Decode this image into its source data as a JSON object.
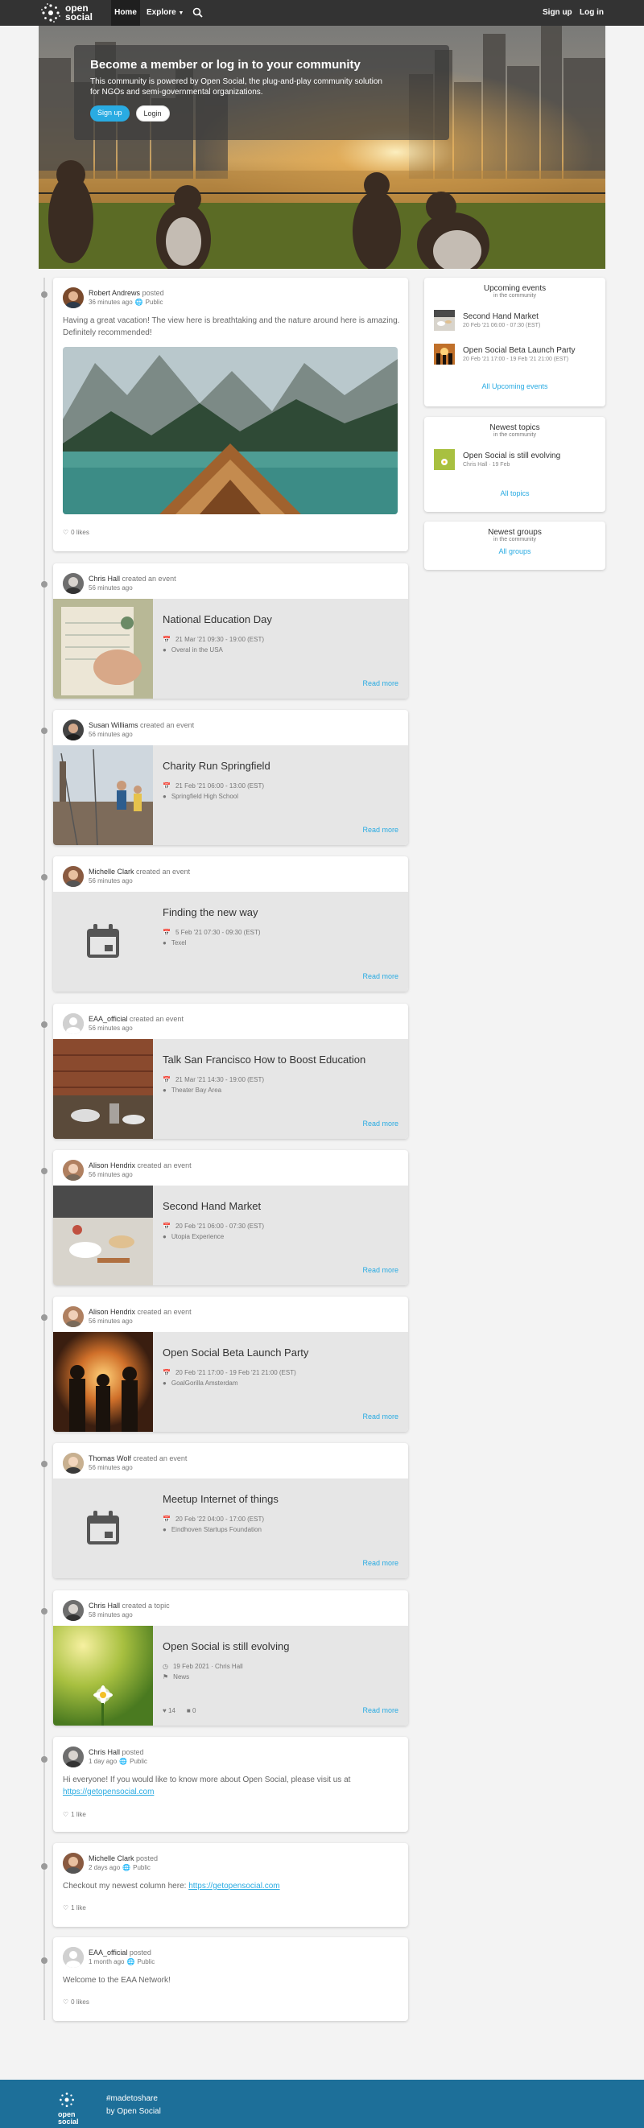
{
  "nav": {
    "logo_top": "open",
    "logo_bottom": "social",
    "home": "Home",
    "explore": "Explore",
    "sign_up": "Sign up",
    "login": "Log in"
  },
  "hero": {
    "title": "Become a member or log in to your community",
    "text": "This community is powered by Open Social, the plug-and-play community solution for NGOs and semi-governmental organizations.",
    "signup_btn": "Sign up",
    "login_btn": "Login"
  },
  "stream": [
    {
      "author": "Robert Andrews",
      "action": "posted",
      "time": "36 minutes ago",
      "visibility": "Public",
      "text": "Having a great vacation! The view here is breathtaking and the nature around here is amazing. Definitely recommended!",
      "likes": "0 likes"
    },
    {
      "author": "Chris Hall",
      "action": "created an event",
      "time": "56 minutes ago",
      "title": "National Education Day",
      "date": "21 Mar '21 09:30 - 19:00 (EST)",
      "location": "Overal in the USA",
      "read_more": "Read more"
    },
    {
      "author": "Susan Williams",
      "action": "created an event",
      "time": "56 minutes ago",
      "title": "Charity Run Springfield",
      "date": "21 Feb '21 06:00 - 13:00 (EST)",
      "location": "Springfield High School",
      "read_more": "Read more"
    },
    {
      "author": "Michelle Clark",
      "action": "created an event",
      "time": "56 minutes ago",
      "title": "Finding the new way",
      "date": "5 Feb '21 07:30 - 09:30 (EST)",
      "location": "Texel",
      "read_more": "Read more"
    },
    {
      "author": "EAA_official",
      "action": "created an event",
      "time": "56 minutes ago",
      "title": "Talk San Francisco How to Boost Education",
      "date": "21 Mar '21 14:30 - 19:00 (EST)",
      "location": "Theater Bay Area",
      "read_more": "Read more"
    },
    {
      "author": "Alison Hendrix",
      "action": "created an event",
      "time": "56 minutes ago",
      "title": "Second Hand Market",
      "date": "20 Feb '21 06:00 - 07:30 (EST)",
      "location": "Utopia Experience",
      "read_more": "Read more"
    },
    {
      "author": "Alison Hendrix",
      "action": "created an event",
      "time": "56 minutes ago",
      "title": "Open Social Beta Launch Party",
      "date": "20 Feb '21 17:00 - 19 Feb '21 21:00 (EST)",
      "location": "GoalGorilla Amsterdam",
      "read_more": "Read more"
    },
    {
      "author": "Thomas Wolf",
      "action": "created an event",
      "time": "56 minutes ago",
      "title": "Meetup Internet of things",
      "date": "20 Feb '22 04:00 - 17:00 (EST)",
      "location": "Eindhoven Startups Foundation",
      "read_more": "Read more"
    },
    {
      "author": "Chris Hall",
      "action": "created a topic",
      "time": "58 minutes ago",
      "title": "Open Social is still evolving",
      "date": "19 Feb 2021 · Chris Hall",
      "location": "News",
      "likes_count": "14",
      "comments_count": "0",
      "read_more": "Read more"
    },
    {
      "author": "Chris Hall",
      "action": "posted",
      "time": "1 day ago",
      "visibility": "Public",
      "text": "Hi everyone! If you would like to know more about Open Social, please visit us at",
      "link": "https://getopensocial.com",
      "likes": "1 like"
    },
    {
      "author": "Michelle Clark",
      "action": "posted",
      "time": "2 days ago",
      "visibility": "Public",
      "text": "Checkout my newest column here:",
      "link": "https://getopensocial.com",
      "likes": "1 like"
    },
    {
      "author": "EAA_official",
      "action": "posted",
      "time": "1 month ago",
      "visibility": "Public",
      "text": "Welcome to the EAA Network!",
      "likes": "0 likes"
    }
  ],
  "sidebar": {
    "events": {
      "title": "Upcoming events",
      "subtitle": "in the community",
      "items": [
        {
          "title": "Second Hand Market",
          "meta": "20 Feb '21 06:00 - 07:30 (EST)"
        },
        {
          "title": "Open Social Beta Launch Party",
          "meta": "20 Feb '21 17:00 - 19 Feb '21 21:00 (EST)"
        }
      ],
      "link": "All Upcoming events"
    },
    "topics": {
      "title": "Newest topics",
      "subtitle": "in the community",
      "items": [
        {
          "title": "Open Social is still evolving",
          "meta": "Chris Hall · 19 Feb"
        }
      ],
      "link": "All topics"
    },
    "groups": {
      "title": "Newest groups",
      "subtitle": "in the community",
      "link": "All groups"
    }
  },
  "footer": {
    "logo_top": "open",
    "logo_bottom": "social",
    "tagline": "#madetoshare",
    "by": "by Open Social"
  },
  "colors": {
    "primary": "#29abe2",
    "navbar": "#333333",
    "footer": "#1d6f99",
    "event_panel": "#e6e6e6"
  }
}
